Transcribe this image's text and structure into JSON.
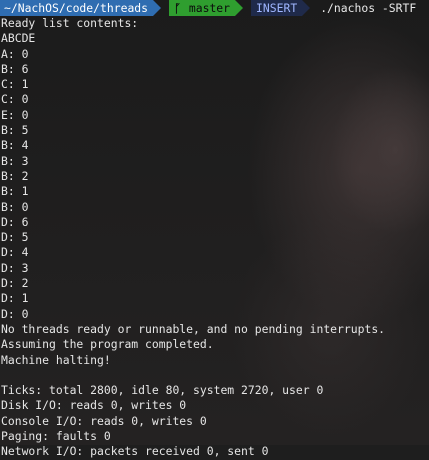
{
  "prompt": {
    "path": "~/NachOS/code/threads",
    "branch_icon": "git-branch-icon",
    "branch": "master",
    "mode": "INSERT",
    "command": "./nachos -SRTF"
  },
  "output_lines": [
    "Ready list contents:",
    "ABCDE",
    "A: 0",
    "B: 6",
    "C: 1",
    "C: 0",
    "E: 0",
    "B: 5",
    "B: 4",
    "B: 3",
    "B: 2",
    "B: 1",
    "B: 0",
    "D: 6",
    "D: 5",
    "D: 4",
    "D: 3",
    "D: 2",
    "D: 1",
    "D: 0",
    "No threads ready or runnable, and no pending interrupts.",
    "Assuming the program completed.",
    "Machine halting!",
    "",
    "Ticks: total 2800, idle 80, system 2720, user 0",
    "Disk I/O: reads 0, writes 0",
    "Console I/O: reads 0, writes 0",
    "Paging: faults 0",
    "Network I/O: packets received 0, sent 0"
  ],
  "colors": {
    "path_bg": "#2f6db1",
    "branch_bg": "#2f9e2f",
    "mode_bg": "#1f2a4a",
    "text": "#e6e6e6"
  }
}
